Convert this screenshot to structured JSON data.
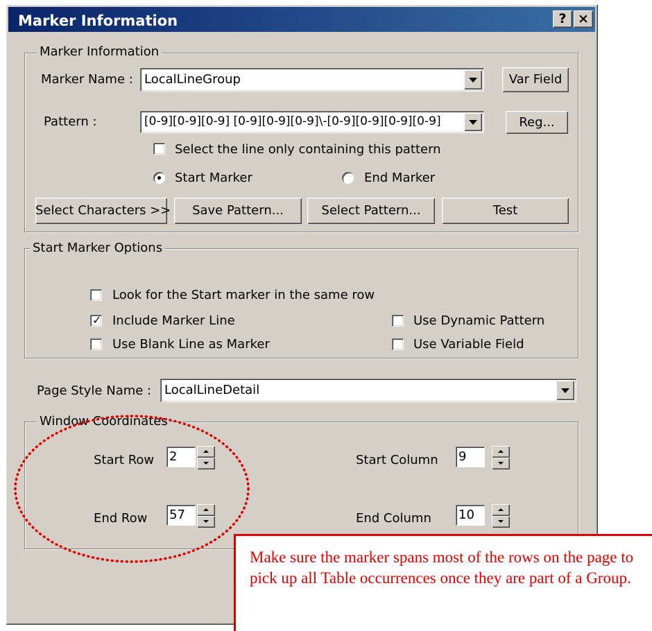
{
  "window": {
    "title": "Marker Information",
    "help_label": "?",
    "close_label": "×"
  },
  "marker_info": {
    "legend": "Marker Information",
    "name_label": "Marker Name :",
    "name_value": "LocalLineGroup",
    "var_field_button": "Var Field",
    "pattern_label": "Pattern :",
    "pattern_value": "[0-9][0-9][0-9] [0-9][0-9][0-9]\\-[0-9][0-9][0-9][0-9]",
    "reg_button": "Reg...",
    "select_line_checkbox": "Select the line only containing this pattern",
    "start_marker_radio": "Start Marker",
    "end_marker_radio": "End Marker",
    "select_characters_button": "Select Characters >>",
    "save_pattern_button": "Save Pattern...",
    "select_pattern_button": "Select Pattern...",
    "test_button": "Test"
  },
  "start_marker_options": {
    "legend": "Start Marker Options",
    "look_same_row": "Look for the Start marker in the same row",
    "include_marker_line": "Include Marker Line",
    "use_blank_line": "Use Blank Line as Marker",
    "use_dynamic_pattern": "Use Dynamic Pattern",
    "use_variable_field": "Use Variable Field"
  },
  "page_style": {
    "label": "Page Style Name :",
    "value": "LocalLineDetail"
  },
  "window_coords": {
    "legend": "Window Coordinates",
    "start_row_label": "Start Row",
    "start_row_value": "2",
    "end_row_label": "End Row",
    "end_row_value": "57",
    "start_col_label": "Start Column",
    "start_col_value": "9",
    "end_col_label": "End Column",
    "end_col_value": "10"
  },
  "callout": {
    "text": "Make sure the marker spans most of the rows on the page to pick up all Table occurrences once they are part of a Group."
  },
  "colors": {
    "titlebar": "#0a246a",
    "dialog_bg": "#d4d0c8",
    "callout_red": "#e00000"
  },
  "checkbox_states": {
    "select_line": false,
    "look_same_row": false,
    "include_marker_line": true,
    "use_blank_line": false,
    "use_dynamic_pattern": false,
    "use_variable_field": false
  },
  "radio_selected": "start_marker"
}
